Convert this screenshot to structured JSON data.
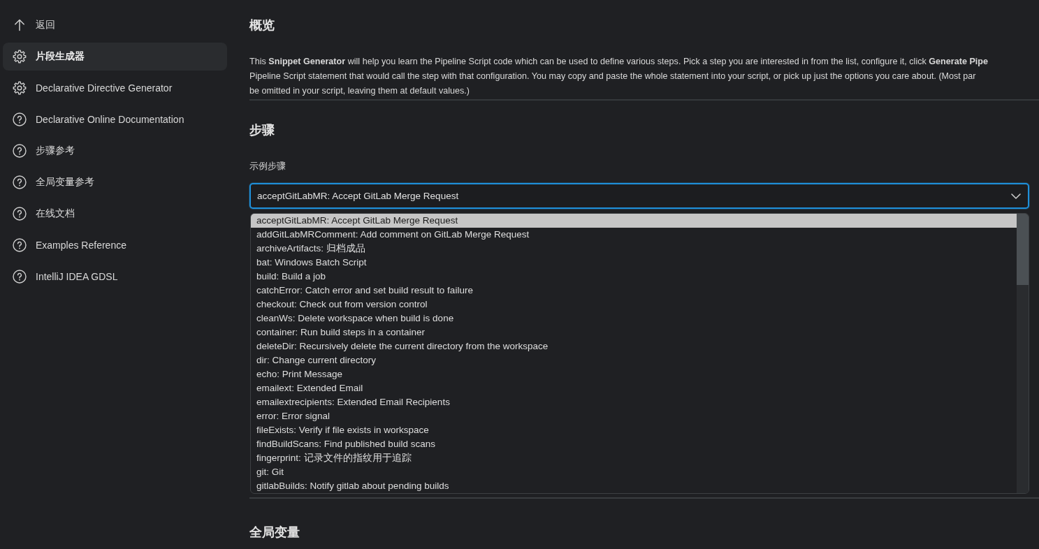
{
  "sidebar": {
    "items": [
      {
        "label": "返回",
        "kind": "back",
        "selected": false
      },
      {
        "label": "片段生成器",
        "kind": "tool",
        "selected": true
      },
      {
        "label": "Declarative Directive Generator",
        "kind": "tool",
        "selected": false
      },
      {
        "label": "Declarative Online Documentation",
        "kind": "help",
        "selected": false
      },
      {
        "label": "步骤参考",
        "kind": "help",
        "selected": false
      },
      {
        "label": "全局变量参考",
        "kind": "help",
        "selected": false
      },
      {
        "label": "在线文档",
        "kind": "help",
        "selected": false
      },
      {
        "label": "Examples Reference",
        "kind": "help",
        "selected": false
      },
      {
        "label": "IntelliJ IDEA GDSL",
        "kind": "help",
        "selected": false
      }
    ]
  },
  "overview": {
    "heading": "概览",
    "lines": [
      "This **Snippet Generator** will help you learn the Pipeline Script code which can be used to define various steps. Pick a step you are interested in from the list, configure it, click **Generate Pipe**",
      "Pipeline Script statement that would call the step with that configuration. You may copy and paste the whole statement into your script, or pick up just the options you care about. (Most par",
      "be omitted in your script, leaving them at default values.)"
    ]
  },
  "steps": {
    "heading": "步骤",
    "field_label": "示例步骤",
    "select": {
      "value": "acceptGitLabMR: Accept GitLab Merge Request",
      "expanded": true
    },
    "options": [
      {
        "label": "acceptGitLabMR: Accept GitLab Merge Request",
        "selected": true
      },
      {
        "label": "addGitLabMRComment: Add comment on GitLab Merge Request",
        "selected": false
      },
      {
        "label": "archiveArtifacts: 归档成品",
        "selected": false
      },
      {
        "label": "bat: Windows Batch Script",
        "selected": false
      },
      {
        "label": "build: Build a job",
        "selected": false
      },
      {
        "label": "catchError: Catch error and set build result to failure",
        "selected": false
      },
      {
        "label": "checkout: Check out from version control",
        "selected": false
      },
      {
        "label": "cleanWs: Delete workspace when build is done",
        "selected": false
      },
      {
        "label": "container: Run build steps in a container",
        "selected": false
      },
      {
        "label": "deleteDir: Recursively delete the current directory from the workspace",
        "selected": false
      },
      {
        "label": "dir: Change current directory",
        "selected": false
      },
      {
        "label": "echo: Print Message",
        "selected": false
      },
      {
        "label": "emailext: Extended Email",
        "selected": false
      },
      {
        "label": "emailextrecipients: Extended Email Recipients",
        "selected": false
      },
      {
        "label": "error: Error signal",
        "selected": false
      },
      {
        "label": "fileExists: Verify if file exists in workspace",
        "selected": false
      },
      {
        "label": "findBuildScans: Find published build scans",
        "selected": false
      },
      {
        "label": "fingerprint: 记录文件的指纹用于追踪",
        "selected": false
      },
      {
        "label": "git: Git",
        "selected": false
      },
      {
        "label": "gitlabBuilds: Notify gitlab about pending builds",
        "selected": false
      }
    ]
  },
  "global_variables": {
    "heading": "全局变量"
  }
}
